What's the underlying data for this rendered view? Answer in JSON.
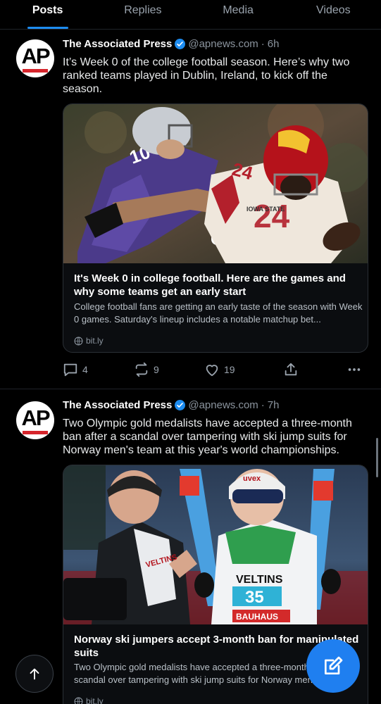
{
  "tabs": [
    {
      "label": "Posts",
      "active": true
    },
    {
      "label": "Replies",
      "active": false
    },
    {
      "label": "Media",
      "active": false
    },
    {
      "label": "Videos",
      "active": false
    }
  ],
  "posts": [
    {
      "author": "The Associated Press",
      "handle": "@apnews.com",
      "separator": "·",
      "time": "6h",
      "text": "It’s Week 0 of the college football season. Here’s why two ranked teams played in Dublin, Ireland, to kick off the season.",
      "card": {
        "title": "It's Week 0 in college football. Here are the games and why some teams get an early start",
        "description": "College football fans are getting an early taste of the season with Week 0 games. Saturday's lineup includes a notable matchup bet...",
        "link": "bit.ly",
        "image_text": {
          "jersey_left": "10",
          "jersey_right": "24",
          "team": "IOWA STATE"
        }
      },
      "stats": {
        "replies": "4",
        "reposts": "9",
        "likes": "19"
      }
    },
    {
      "author": "The Associated Press",
      "handle": "@apnews.com",
      "separator": "·",
      "time": "7h",
      "text": "Two Olympic gold medalists have accepted a three-month ban after a scandal over tampering with ski jump suits for Norway men's team at this year's world championships.",
      "card": {
        "title": "Norway ski jumpers accept 3-month ban for manipulated suits",
        "description": "Two Olympic gold medalists have accepted a three-month ban after a scandal over tampering with ski jump suits for Norway men's team...",
        "link": "bit.ly",
        "image_text": {
          "sponsor": "VELTINS",
          "bib": "35",
          "event": "BAUHAUS",
          "brand": "uvex"
        }
      }
    }
  ],
  "avatar_text": "AP",
  "colors": {
    "accent": "#1d8cf0",
    "background": "#000000",
    "ap_red": "#d6252c"
  }
}
